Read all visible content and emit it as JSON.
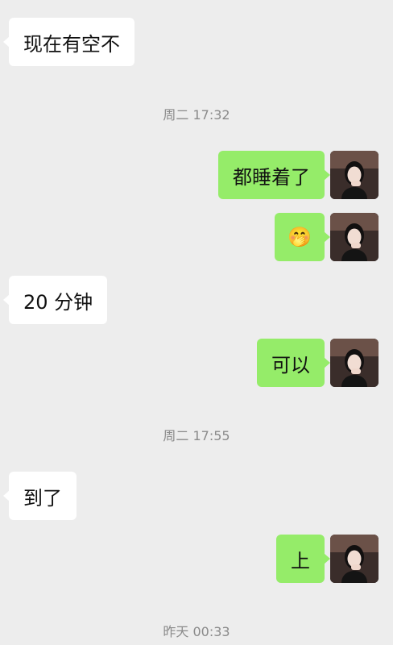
{
  "messages": {
    "m1": "现在有空不",
    "m2": "都睡着了",
    "m3_emoji": "🤭",
    "m4": "20 分钟",
    "m5": "可以",
    "m6": "到了",
    "m7": "上"
  },
  "timestamps": {
    "t1": "周二 17:32",
    "t2": "周二 17:55",
    "t3": "昨天 00:33"
  },
  "colors": {
    "background": "#ededed",
    "incoming_bubble": "#ffffff",
    "outgoing_bubble": "#95ec69",
    "timestamp_text": "#8a8a8a"
  },
  "icons": {
    "avatar": "user-avatar"
  }
}
